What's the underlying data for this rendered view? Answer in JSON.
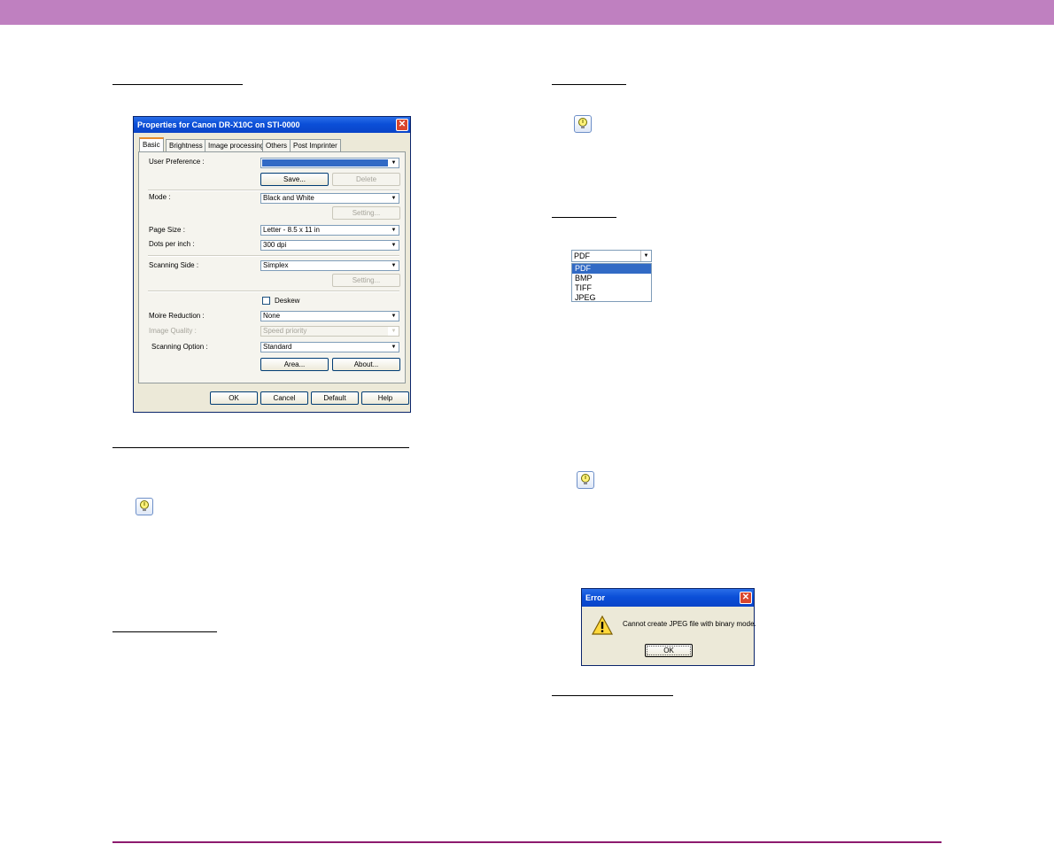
{
  "properties_dialog": {
    "title": "Properties for Canon DR-X10C on STI-0000",
    "close_glyph": "✕",
    "tabs": [
      "Basic",
      "Brightness",
      "Image processing",
      "Others",
      "Post Imprinter"
    ],
    "labels": {
      "user_preference": "User Preference :",
      "mode": "Mode :",
      "page_size": "Page Size :",
      "dots_per_inch": "Dots per inch :",
      "scanning_side": "Scanning Side :",
      "moire_reduction": "Moire Reduction :",
      "image_quality": "Image Quality :",
      "scanning_option": "Scanning Option :"
    },
    "values": {
      "user_preference": "",
      "mode": "Black and White",
      "page_size": "Letter - 8.5 x 11 in",
      "dots_per_inch": "300 dpi",
      "scanning_side": "Simplex",
      "moire_reduction": "None",
      "image_quality": "Speed priority",
      "scanning_option": "Standard"
    },
    "buttons": {
      "save": "Save...",
      "delete": "Delete",
      "mode_setting": "Setting...",
      "side_setting": "Setting...",
      "area": "Area...",
      "about": "About...",
      "ok": "OK",
      "cancel": "Cancel",
      "default": "Default",
      "help": "Help"
    },
    "deskew_label": "Deskew",
    "deskew_checked": false
  },
  "file_type_dropdown": {
    "selected": "PDF",
    "options": [
      "PDF",
      "BMP",
      "TIFF",
      "JPEG"
    ],
    "highlighted": "PDF"
  },
  "error_dialog": {
    "title": "Error",
    "message": "Cannot create JPEG file with binary mode.",
    "ok_label": "OK",
    "icon": "warning-icon"
  },
  "hint_icons": [
    "hint-icon",
    "hint-icon",
    "hint-icon"
  ],
  "colors": {
    "top_bar": "#bf80c0",
    "bottom_rule": "#8c1a6e",
    "xp_title": "#0b4fd8",
    "selection": "#316ac5"
  }
}
